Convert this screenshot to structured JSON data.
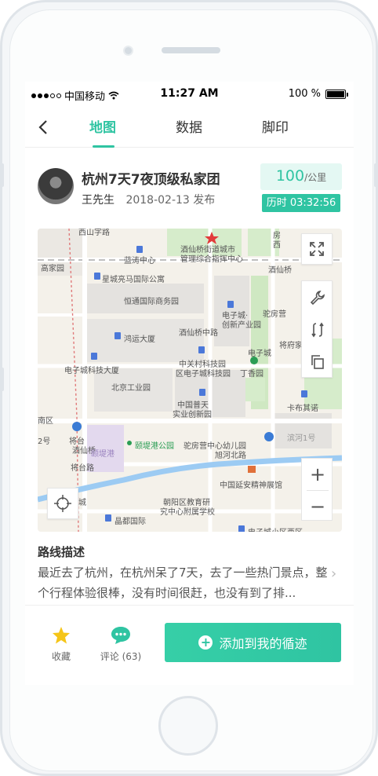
{
  "status_bar": {
    "carrier": "中国移动",
    "time": "11:27 AM",
    "battery": "100 %",
    "battery_level": 1.0
  },
  "nav": {
    "tabs": [
      {
        "label": "地图",
        "active": true
      },
      {
        "label": "数据",
        "active": false
      },
      {
        "label": "脚印",
        "active": false
      }
    ]
  },
  "route": {
    "title": "杭州7天7夜顶级私家团",
    "author": "王先生",
    "published": "2018-02-13 发布",
    "distance_value": "100",
    "distance_unit": "/公里",
    "duration": "历时 03:32:56"
  },
  "map": {
    "labels": [
      "西山字路",
      "蓝涛中心",
      "酒仙桥街道城市",
      "管理综合指挥中心",
      "房",
      "西",
      "高家园",
      "酒仙桥",
      "星城亮马国际公寓",
      "恒通国际商务园",
      "驼房营",
      "电子城·",
      "创新产业园",
      "电子城",
      "鸿运大厦",
      "酒仙桥中路",
      "将府家园",
      "中关村科技园",
      "区电子城科技园",
      "丁香园",
      "北京工业园",
      "电子城科技大厦",
      "中国普天",
      "实业创新园",
      "卡布其诺",
      "南区",
      "将台",
      "酒仙桥",
      "将台路",
      "颐堤港",
      "颐堤港公园",
      "驼房营中心幼儿园",
      "旭河北路",
      "滨河1号",
      "中国延安精神展馆",
      "城",
      "朝阳区教育研",
      "究中心附属学校",
      "晶都国际",
      "电子城小区西区",
      "2号"
    ],
    "icons": [
      "fullscreen-icon",
      "wrench-icon",
      "route-swap-icon",
      "copy-icon",
      "locate-icon",
      "zoom-in-icon",
      "zoom-out-icon"
    ]
  },
  "description": {
    "title": "路线描述",
    "text": "最近去了杭州，在杭州呆了7天，去了一些热门景点，整个行程体验很棒，没有时间很赶，也没有到了排..."
  },
  "bottom_bar": {
    "favorite_label": "收藏",
    "comment_label": "评论 (63)",
    "add_label": "添加到我的循迹"
  },
  "colors": {
    "accent": "#2fc4a2",
    "accent_light": "#e4f8f3",
    "favorite_star": "#f5c518"
  }
}
